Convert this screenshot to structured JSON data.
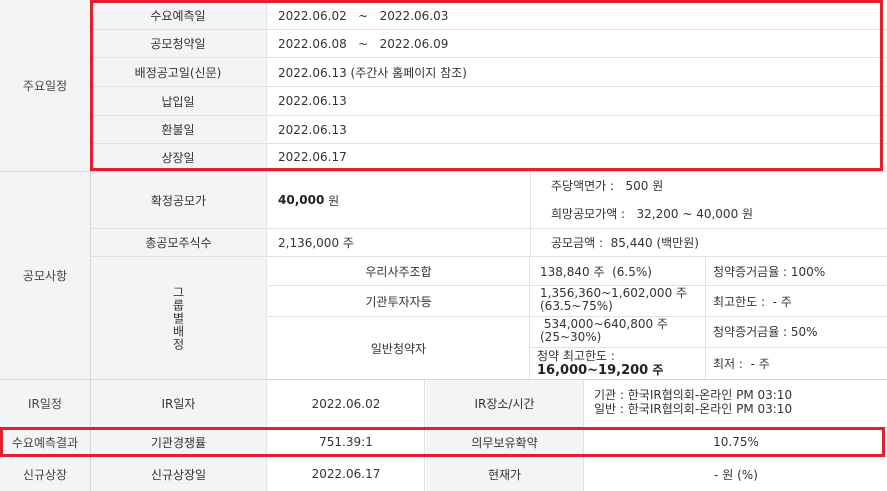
{
  "schedule": {
    "header": "주요일정",
    "rows": [
      {
        "label": "수요예측일",
        "value": "2022.06.02   ~   2022.06.03"
      },
      {
        "label": "공모청약일",
        "value": "2022.06.08   ~   2022.06.09"
      },
      {
        "label": "배정공고일(신문)",
        "value": "2022.06.13 (주간사 홈페이지 참조)"
      },
      {
        "label": "납입일",
        "value": "2022.06.13"
      },
      {
        "label": "환불일",
        "value": "2022.06.13"
      },
      {
        "label": "상장일",
        "value": "2022.06.17"
      }
    ]
  },
  "offering": {
    "header": "공모사항",
    "price_label": "확정공모가",
    "price_value": "40,000",
    "price_unit": " 원",
    "par_value": "주당액면가 :   500 원",
    "hope_price": "희망공모가액 :   32,200 ~ 40,000 원",
    "shares_label": "총공모주식수",
    "shares_value": "2,136,000 주",
    "amount": "공모금액 :  85,440 (백만원)",
    "group_label": "그룹별배정",
    "groups": [
      {
        "name": "우리사주조합",
        "qty": "138,840 주  (6.5%)",
        "extra": "청약증거금율 : 100%"
      },
      {
        "name": "기관투자자등",
        "qty": "1,356,360~1,602,000 주",
        "qty2": "(63.5~75%)",
        "extra": "최고한도 :  - 주"
      },
      {
        "name": "일반청약자",
        "qty": " 534,000~640,800 주",
        "qty2": "(25~30%)",
        "extra": "청약증거금율 : 50%",
        "limit_label": "청약 최고한도 :",
        "limit_value": "16,000~19,200",
        "limit_unit": " 주",
        "extra2": "최저 :  - 주"
      }
    ]
  },
  "ir": {
    "header": "IR일정",
    "date_label": "IR일자",
    "date_value": "2022.06.02",
    "place_label": "IR장소/시간",
    "place_line1": "기관 : 한국IR협의회-온라인 PM 03:10",
    "place_line2": "일반 : 한국IR협의회-온라인 PM 03:10"
  },
  "forecast": {
    "header": "수요예측결과",
    "comp_label": "기관경쟁률",
    "comp_value": "751.39:1",
    "lock_label": "의무보유확약",
    "lock_value": "10.75%"
  },
  "listing": {
    "header": "신규상장",
    "date_label": "신규상장일",
    "date_value": "2022.06.17",
    "price_label": "현재가",
    "price_value": "- 원 (%)"
  },
  "colors": {
    "highlight": "#e0202a",
    "label_bg": "#f3f4f6",
    "border": "#d6d6d6"
  }
}
